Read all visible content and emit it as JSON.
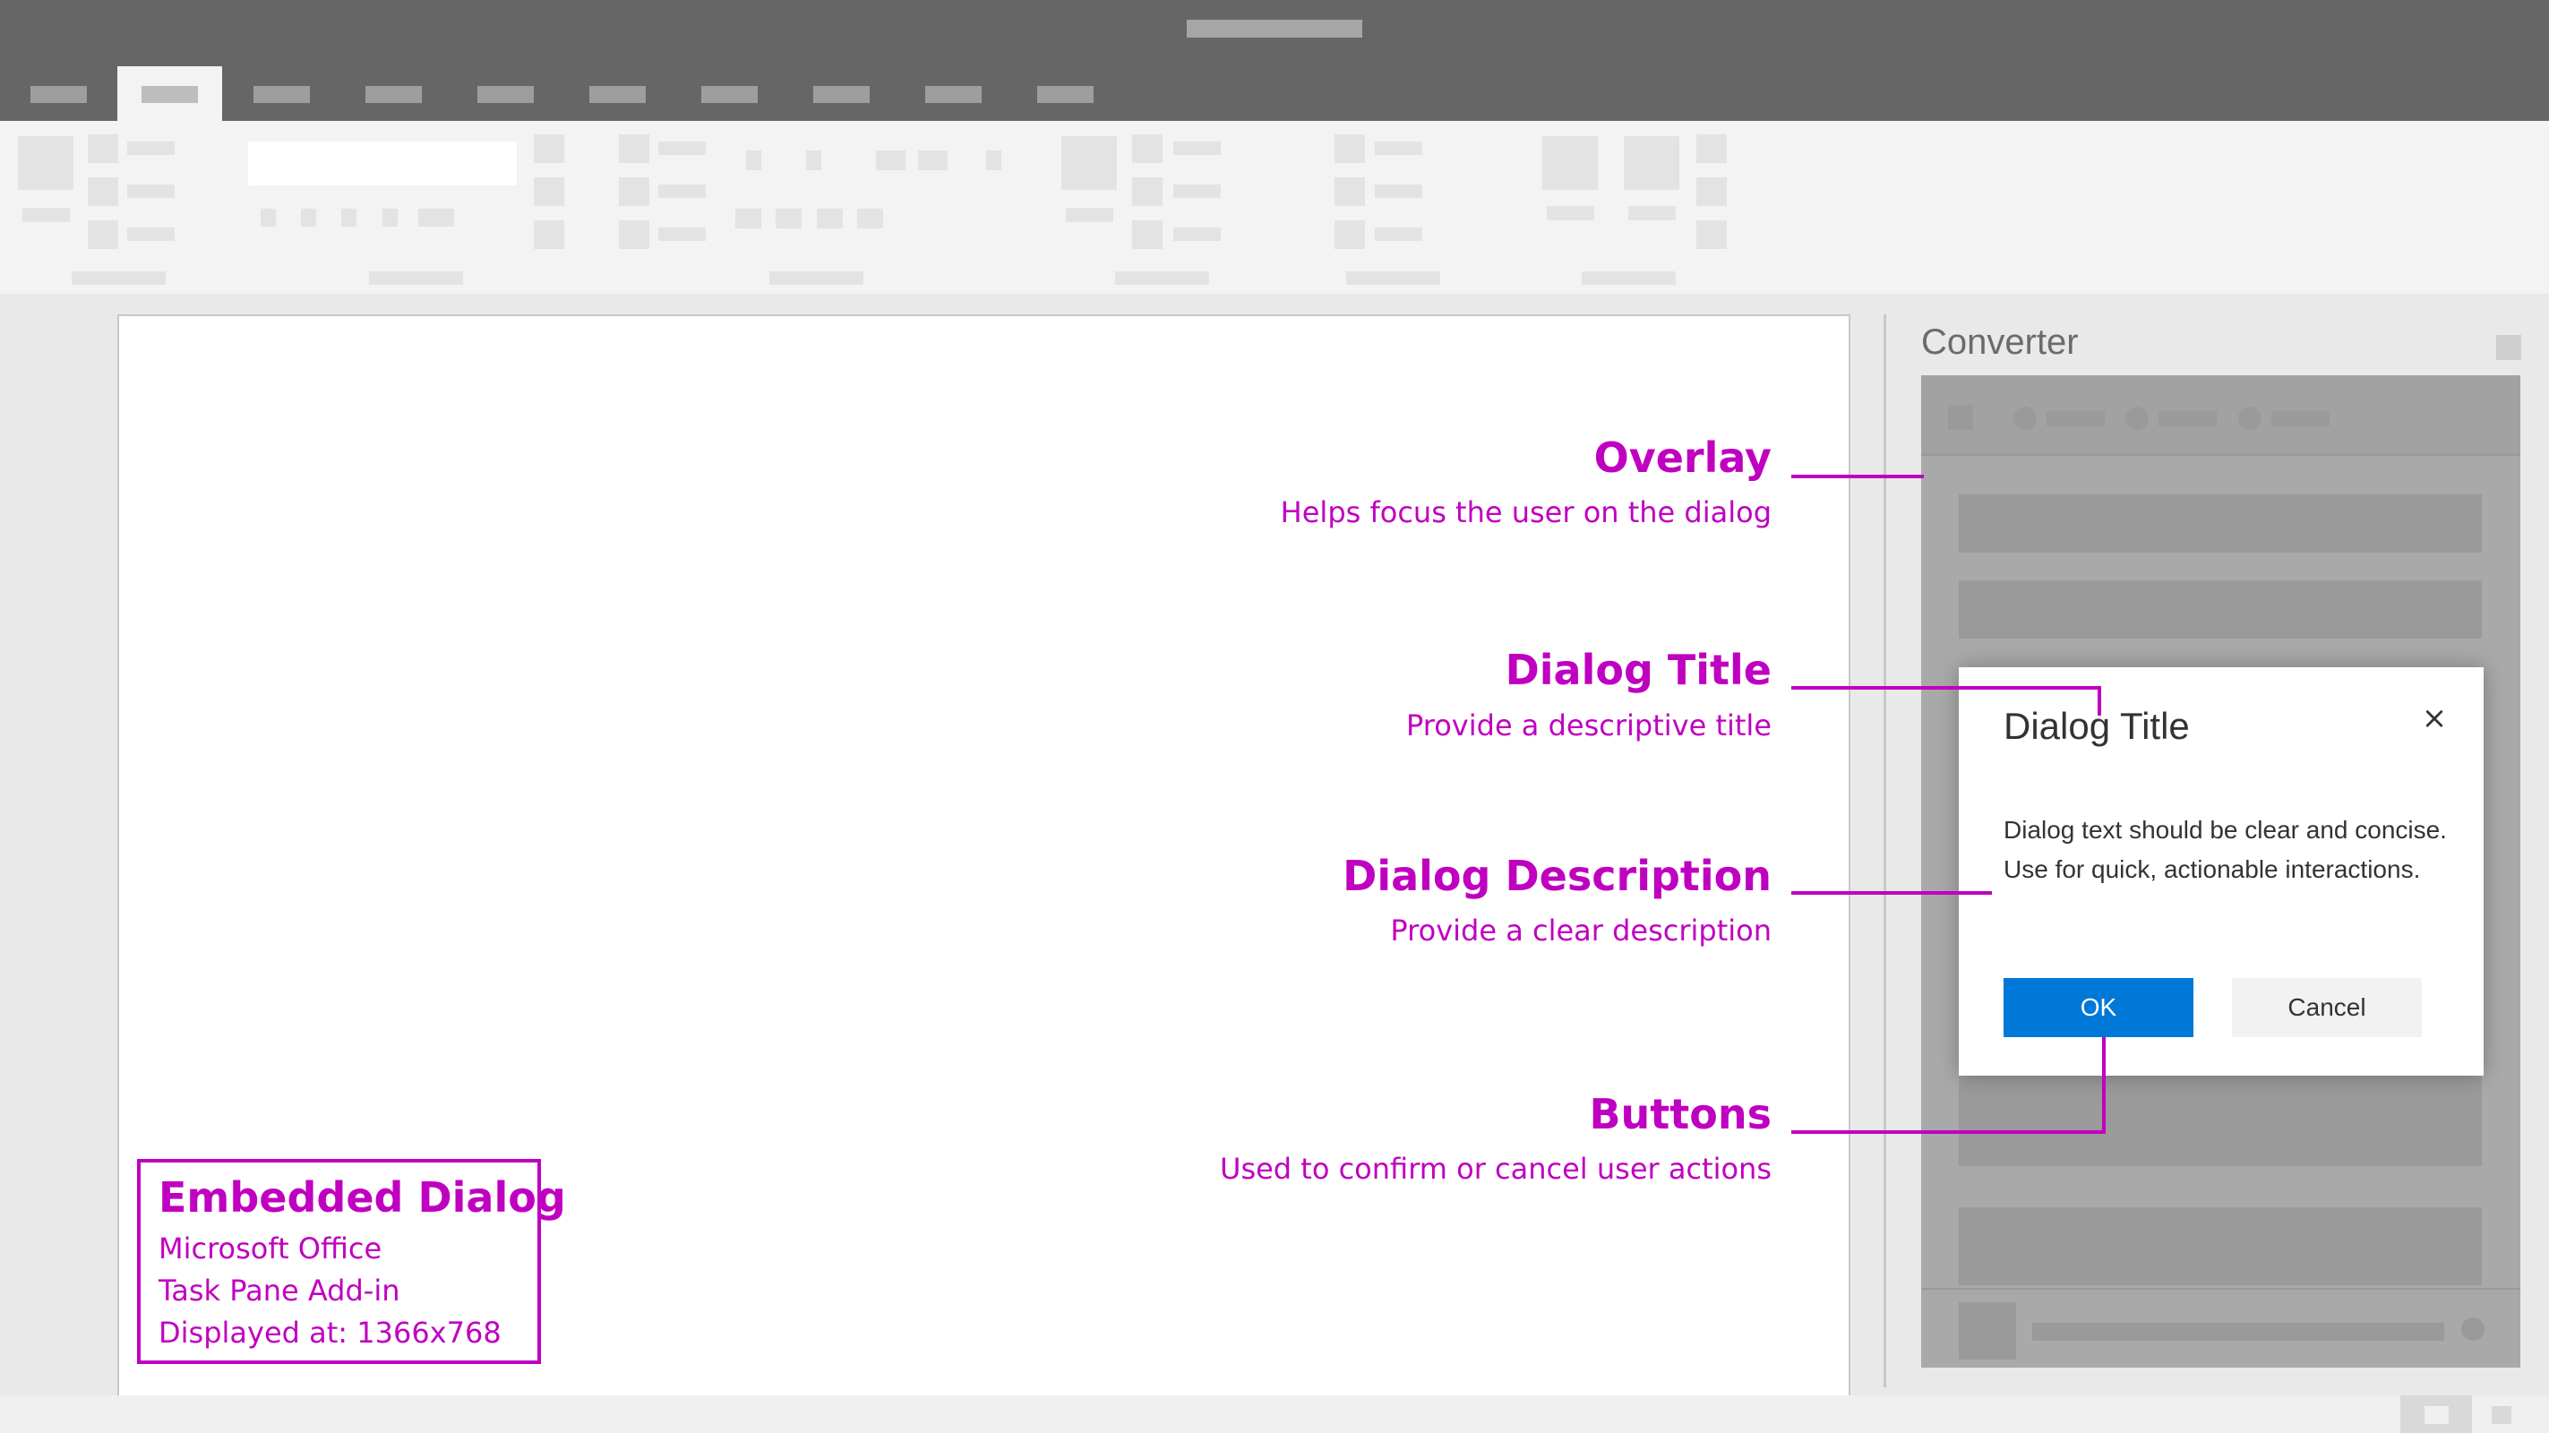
{
  "task_pane": {
    "title": "Converter"
  },
  "dialog": {
    "title": "Dialog Title",
    "close_glyph": "×",
    "description": "Dialog text should be clear and concise. Use for quick, actionable interactions.",
    "ok_label": "OK",
    "cancel_label": "Cancel"
  },
  "annotations": [
    {
      "heading": "Overlay",
      "text": "Helps focus the user on the dialog"
    },
    {
      "heading": "Dialog Title",
      "text": "Provide a descriptive title"
    },
    {
      "heading": "Dialog Description",
      "text": "Provide a clear description"
    },
    {
      "heading": "Buttons",
      "text": "Used to confirm or cancel user actions"
    }
  ],
  "embedded_box": {
    "title": "Embedded Dialog",
    "lines": [
      "Microsoft Office",
      "Task Pane Add-in",
      "Displayed at: 1366x768"
    ]
  },
  "colors": {
    "annotation": "#c000c0",
    "primary_button": "#0078d7",
    "title_bar": "#666666",
    "overlay": "#a9a9a9"
  },
  "icons": {
    "dialog_close": "close-icon"
  }
}
